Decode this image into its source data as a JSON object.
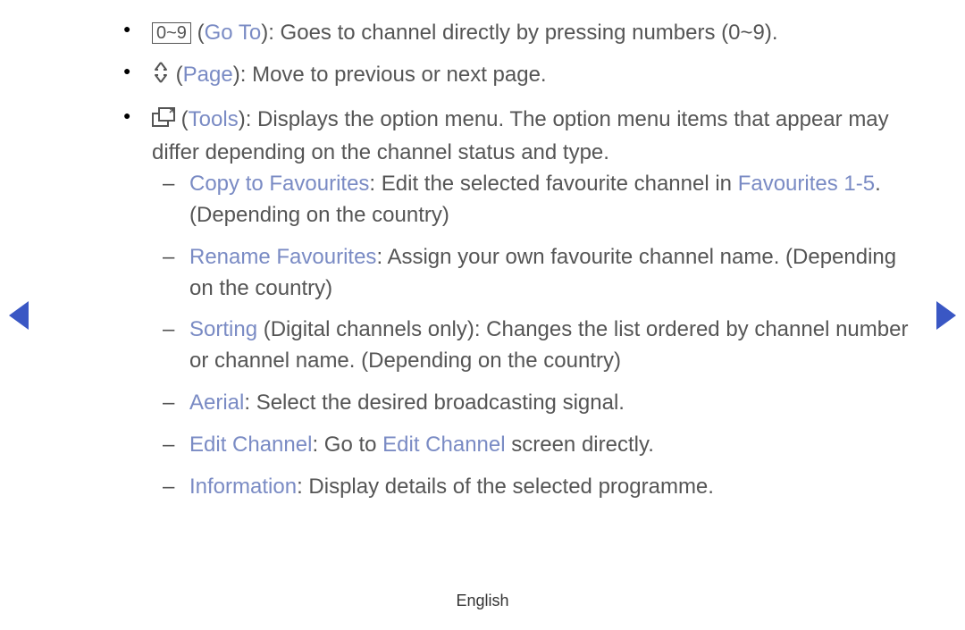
{
  "items": [
    {
      "boxed": "0~9",
      "label": "Go To",
      "desc": ": Goes to channel directly by pressing numbers (0~9)."
    },
    {
      "icon": "page",
      "label": "Page",
      "desc": ": Move to previous or next page."
    },
    {
      "icon": "tools",
      "label": "Tools",
      "desc_a": ": Displays the option menu. The option menu items that appear may differ depending on the channel status and type.",
      "subs": [
        {
          "label": "Copy to Favourites",
          "t1": ": Edit the selected favourite channel in ",
          "blue2": "Favourites 1-5",
          "t2": ". (Depending on the country)"
        },
        {
          "label": "Rename Favourites",
          "t1": ": Assign your own favourite channel name. (Depending on the country)"
        },
        {
          "label": "Sorting",
          "t1": " (Digital channels only): Changes the list ordered by channel number or channel name. (Depending on the country)"
        },
        {
          "label": "Aerial",
          "t1": ": Select the desired broadcasting signal."
        },
        {
          "label": "Edit Channel",
          "t1": ": Go to ",
          "blue2": "Edit Channel",
          "t2": " screen directly."
        },
        {
          "label": "Information",
          "t1": ": Display details of the selected programme."
        }
      ]
    }
  ],
  "footer": "English"
}
